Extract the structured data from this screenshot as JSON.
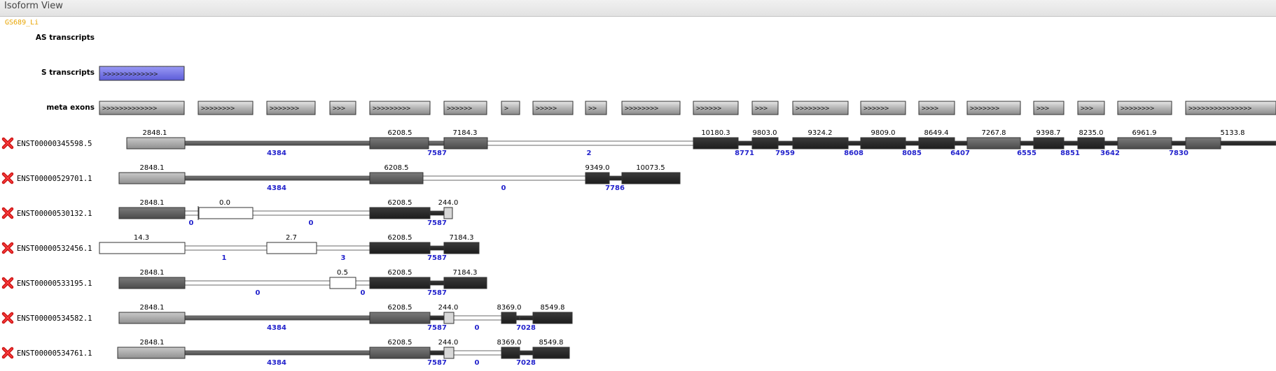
{
  "window": {
    "title": "Isoform View"
  },
  "gene": {
    "id": "GS689_Li"
  },
  "labels": {
    "as": "AS transcripts",
    "s": "S transcripts",
    "meta": "meta exons"
  },
  "s_transcript": {
    "chevrons": ">>>>>>>>>>>>>",
    "color": "#7777ee"
  },
  "meta_exons": [
    {
      "chev": ">>>>>>>>>>>>>"
    },
    {
      "chev": ">>>>>>>>"
    },
    {
      "chev": ">>>>>>>"
    },
    {
      "chev": ">>>"
    },
    {
      "chev": ">>>>>>>>>"
    },
    {
      "chev": ">>>>>>"
    },
    {
      "chev": ">"
    },
    {
      "chev": ">>>>>"
    },
    {
      "chev": ">>"
    },
    {
      "chev": ">>>>>>>>"
    },
    {
      "chev": ">>>>>>"
    },
    {
      "chev": ">>>"
    },
    {
      "chev": ">>>>>>>>"
    },
    {
      "chev": ">>>>>>"
    },
    {
      "chev": ">>>>"
    },
    {
      "chev": ">>>>>>>"
    },
    {
      "chev": ">>>"
    },
    {
      "chev": ">>>"
    },
    {
      "chev": ">>>>>>>>"
    },
    {
      "chev": ">>>>>>>>>>>>>>>"
    }
  ],
  "transcripts": [
    {
      "id": "ENST00000345598.5",
      "exons": [
        "2848.1",
        "6208.5",
        "7184.3",
        "10180.3",
        "9803.0",
        "9324.2",
        "9809.0",
        "8649.4",
        "7267.8",
        "9398.7",
        "8235.0",
        "6961.9",
        "5133.8"
      ],
      "introns": [
        "4384",
        "7587",
        "2",
        "8771",
        "7959",
        "8608",
        "8085",
        "6407",
        "6555",
        "8851",
        "3642",
        "7830"
      ]
    },
    {
      "id": "ENST00000529701.1",
      "exons": [
        "2848.1",
        "6208.5",
        "9349.0",
        "10073.5"
      ],
      "introns": [
        "4384",
        "0",
        "7786"
      ]
    },
    {
      "id": "ENST00000530132.1",
      "exons": [
        "2848.1",
        "0.0",
        "6208.5",
        "244.0"
      ],
      "introns": [
        "0",
        "0",
        "7587"
      ]
    },
    {
      "id": "ENST00000532456.1",
      "exons": [
        "14.3",
        "2.7",
        "6208.5",
        "7184.3"
      ],
      "introns": [
        "1",
        "3",
        "7587"
      ]
    },
    {
      "id": "ENST00000533195.1",
      "exons": [
        "2848.1",
        "0.5",
        "6208.5",
        "7184.3"
      ],
      "introns": [
        "0",
        "0",
        "7587"
      ]
    },
    {
      "id": "ENST00000534582.1",
      "exons": [
        "2848.1",
        "6208.5",
        "244.0",
        "8369.0",
        "8549.8"
      ],
      "introns": [
        "4384",
        "7587",
        "0",
        "7028"
      ]
    },
    {
      "id": "ENST00000534761.1",
      "exons": [
        "2848.1",
        "6208.5",
        "244.0",
        "8369.0",
        "8549.8"
      ],
      "introns": [
        "4384",
        "7587",
        "0",
        "7028"
      ]
    }
  ]
}
